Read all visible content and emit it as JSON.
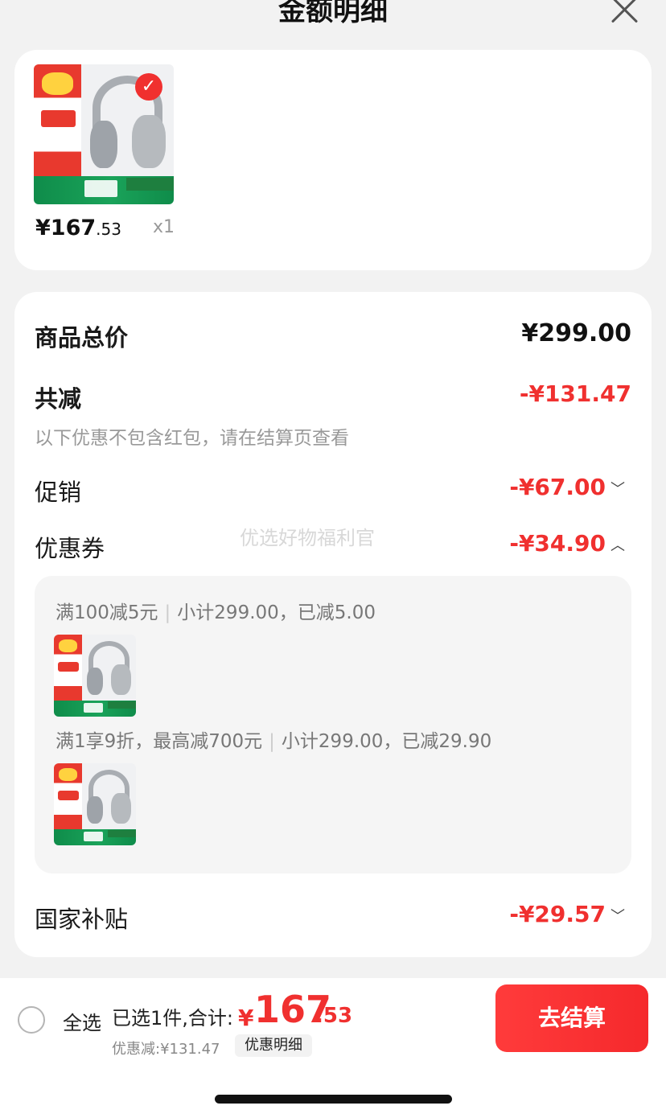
{
  "header": {
    "title": "金额明细"
  },
  "product": {
    "price_int": "¥167",
    "price_dec": ".53",
    "quantity": "x1",
    "checked_mark": "✓"
  },
  "detail": {
    "total_label": "商品总价",
    "total_value": "¥299.00",
    "reduce_label": "共减",
    "reduce_value": "-¥131.47",
    "reduce_note": "以下优惠不包含红包，请在结算页查看",
    "promo_label": "促销",
    "promo_value": "-¥67.00",
    "coupon_label": "优惠券",
    "coupon_value": "-¥34.90",
    "coupons": [
      {
        "rule": "满100减5元",
        "subtotal": "小计299.00，已减5.00"
      },
      {
        "rule": "满1享9折，最高减700元",
        "subtotal": "小计299.00，已减29.90"
      }
    ],
    "subsidy_label": "国家补贴",
    "subsidy_value": "-¥29.57",
    "watermark": "优选好物福利官"
  },
  "bottom_bar": {
    "select_all": "全选",
    "summary": "已选1件,合计:",
    "total_symbol": "¥",
    "total_int": "167",
    "total_dec": ".53",
    "discount_text": "优惠减:¥131.47",
    "detail_tag": "优惠明细",
    "checkout": "去结算"
  },
  "colors": {
    "accent_red": "#f0302f",
    "background": "#f2f2f2",
    "card": "#ffffff"
  },
  "icons": {
    "close": "close-icon",
    "check": "check-badge-icon",
    "chevron_down": "chevron-down-icon",
    "chevron_up": "chevron-up-icon"
  }
}
